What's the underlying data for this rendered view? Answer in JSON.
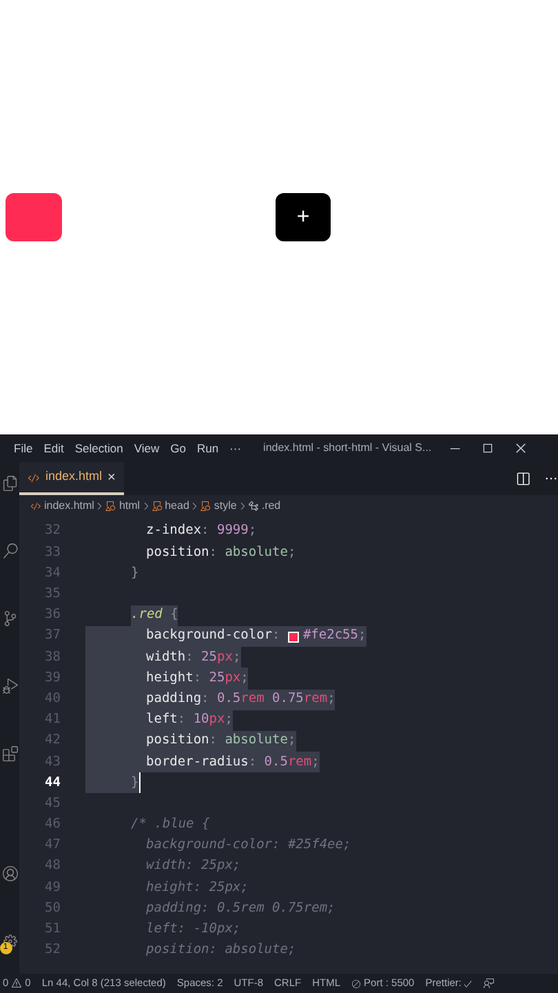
{
  "preview": {
    "red_box": {
      "color": "#fe2c55"
    },
    "add_button": {
      "label": "+"
    }
  },
  "menu_bar": {
    "items": [
      "File",
      "Edit",
      "Selection",
      "View",
      "Go",
      "Run",
      "···"
    ],
    "title": "index.html - short-html - Visual S..."
  },
  "tabs": [
    {
      "label": "index.html",
      "selected": true,
      "close": "×"
    }
  ],
  "breadcrumb": [
    "index.html",
    "html",
    "head",
    "style",
    ".red"
  ],
  "code_lines": [
    {
      "number": "32",
      "kind": "decl",
      "selected": false,
      "current": false,
      "tokens": [
        {
          "kind": "prop",
          "text": "z-index"
        },
        {
          "kind": "punct",
          "text": ":"
        },
        {
          "kind": "num",
          "text": "9999"
        },
        {
          "kind": "punct",
          "text": ";"
        }
      ]
    },
    {
      "number": "33",
      "kind": "decl",
      "selected": false,
      "current": false,
      "tokens": [
        {
          "kind": "prop",
          "text": "position"
        },
        {
          "kind": "punct",
          "text": ":"
        },
        {
          "kind": "value",
          "text": "absolute"
        },
        {
          "kind": "punct",
          "text": ";"
        }
      ]
    },
    {
      "number": "34",
      "kind": "close",
      "selected": false,
      "current": false,
      "tokens": [
        {
          "kind": "punct",
          "text": "}"
        }
      ]
    },
    {
      "number": "35",
      "kind": "blank"
    },
    {
      "number": "36",
      "kind": "rule",
      "selected": true,
      "current": false,
      "tokens": [
        {
          "kind": "selector",
          "text": ".red"
        },
        {
          "kind": "punct",
          "text": "{"
        }
      ]
    },
    {
      "number": "37",
      "kind": "decl",
      "selected": true,
      "current": false,
      "tokens": [
        {
          "kind": "prop",
          "text": "background-color"
        },
        {
          "kind": "punct",
          "text": ":"
        },
        {
          "kind": "swatch",
          "color": "#fe2c55"
        },
        {
          "kind": "num",
          "text": "#fe2c55"
        },
        {
          "kind": "punct",
          "text": ";"
        }
      ]
    },
    {
      "number": "38",
      "kind": "decl",
      "selected": true,
      "current": false,
      "tokens": [
        {
          "kind": "prop",
          "text": "width"
        },
        {
          "kind": "punct",
          "text": ":"
        },
        {
          "kind": "num",
          "text": "25"
        },
        {
          "kind": "unit",
          "text": "px"
        },
        {
          "kind": "punct",
          "text": ";"
        }
      ]
    },
    {
      "number": "39",
      "kind": "decl",
      "selected": true,
      "current": false,
      "tokens": [
        {
          "kind": "prop",
          "text": "height"
        },
        {
          "kind": "punct",
          "text": ":"
        },
        {
          "kind": "num",
          "text": "25"
        },
        {
          "kind": "unit",
          "text": "px"
        },
        {
          "kind": "punct",
          "text": ";"
        }
      ]
    },
    {
      "number": "40",
      "kind": "decl",
      "selected": true,
      "current": false,
      "tokens": [
        {
          "kind": "prop",
          "text": "padding"
        },
        {
          "kind": "punct",
          "text": ":"
        },
        {
          "kind": "num",
          "text": "0.5"
        },
        {
          "kind": "unit",
          "text": "rem"
        },
        {
          "kind": "num",
          "text": "0.75"
        },
        {
          "kind": "unit",
          "text": "rem"
        },
        {
          "kind": "punct",
          "text": ";"
        }
      ]
    },
    {
      "number": "41",
      "kind": "decl",
      "selected": true,
      "current": false,
      "tokens": [
        {
          "kind": "prop",
          "text": "left"
        },
        {
          "kind": "punct",
          "text": ":"
        },
        {
          "kind": "num",
          "text": "10"
        },
        {
          "kind": "unit",
          "text": "px"
        },
        {
          "kind": "punct",
          "text": ";"
        }
      ]
    },
    {
      "number": "42",
      "kind": "decl",
      "selected": true,
      "current": false,
      "tokens": [
        {
          "kind": "prop",
          "text": "position"
        },
        {
          "kind": "punct",
          "text": ":"
        },
        {
          "kind": "value",
          "text": "absolute"
        },
        {
          "kind": "punct",
          "text": ";"
        }
      ]
    },
    {
      "number": "43",
      "kind": "decl",
      "selected": true,
      "current": false,
      "tokens": [
        {
          "kind": "prop",
          "text": "border-radius"
        },
        {
          "kind": "punct",
          "text": ":"
        },
        {
          "kind": "num",
          "text": "0.5"
        },
        {
          "kind": "unit",
          "text": "rem"
        },
        {
          "kind": "punct",
          "text": ";"
        }
      ]
    },
    {
      "number": "44",
      "kind": "close",
      "selected": true,
      "current": true,
      "tokens": [
        {
          "kind": "punct",
          "text": "}"
        }
      ]
    },
    {
      "number": "45",
      "kind": "blank"
    },
    {
      "number": "46",
      "kind": "rule",
      "selected": false,
      "current": false,
      "tokens": [
        {
          "kind": "comment",
          "text": "/* .blue {"
        }
      ]
    },
    {
      "number": "47",
      "kind": "decl",
      "selected": false,
      "current": false,
      "tokens": [
        {
          "kind": "comment",
          "text": "background-color: #25f4ee;"
        }
      ]
    },
    {
      "number": "48",
      "kind": "decl",
      "selected": false,
      "current": false,
      "tokens": [
        {
          "kind": "comment",
          "text": "width: 25px;"
        }
      ]
    },
    {
      "number": "49",
      "kind": "decl",
      "selected": false,
      "current": false,
      "tokens": [
        {
          "kind": "comment",
          "text": "height: 25px;"
        }
      ]
    },
    {
      "number": "50",
      "kind": "decl",
      "selected": false,
      "current": false,
      "tokens": [
        {
          "kind": "comment",
          "text": "padding: 0.5rem 0.75rem;"
        }
      ]
    },
    {
      "number": "51",
      "kind": "decl",
      "selected": false,
      "current": false,
      "tokens": [
        {
          "kind": "comment",
          "text": "left: -10px;"
        }
      ]
    },
    {
      "number": "52",
      "kind": "decl",
      "selected": false,
      "current": false,
      "tokens": [
        {
          "kind": "comment",
          "text": "position: absolute;"
        }
      ]
    }
  ],
  "activity_badge": "1",
  "status_bar": {
    "errors": "0",
    "warnings": "0",
    "items": [
      "Ln 44, Col 8 (213 selected)",
      "Spaces: 2",
      "UTF-8",
      "CRLF",
      "HTML"
    ],
    "port": "Port : 5500",
    "prettier": "Prettier:"
  }
}
